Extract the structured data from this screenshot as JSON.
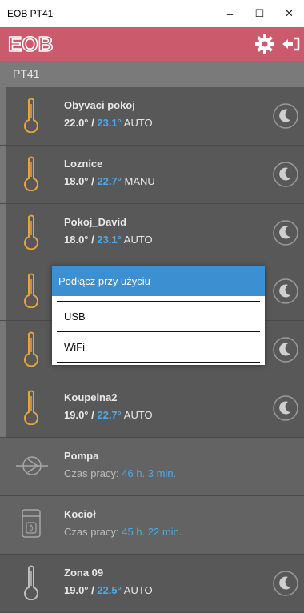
{
  "window": {
    "title": "EOB PT41",
    "min": "–",
    "max": "☐",
    "close": "✕"
  },
  "app": {
    "logo": "EOB",
    "settings_icon": "gear-icon",
    "logout_icon": "exit-icon"
  },
  "device": {
    "name": "PT41"
  },
  "zones": [
    {
      "name": "Obyvaci pokoj",
      "set": "22.0°",
      "sep": " / ",
      "actual": "23.1°",
      "mode": "AUTO"
    },
    {
      "name": "Loznice",
      "set": "18.0°",
      "sep": " / ",
      "actual": "22.7°",
      "mode": "MANU"
    },
    {
      "name": "Pokoj_David",
      "set": "18.0°",
      "sep": " / ",
      "actual": "23.1°",
      "mode": "AUTO"
    },
    {
      "name": "",
      "set": "",
      "sep": "",
      "actual": "",
      "mode": ""
    },
    {
      "name": "",
      "set": "",
      "sep": "",
      "actual": "",
      "mode": ""
    },
    {
      "name": "Koupelna2",
      "set": "19.0°",
      "sep": " / ",
      "actual": "22.7°",
      "mode": "AUTO"
    }
  ],
  "pump": {
    "name": "Pompa",
    "label": "Czas pracy: ",
    "value": "46 h. 3 min."
  },
  "boiler": {
    "name": "Kocioł",
    "label": "Czas pracy: ",
    "value": "45 h. 22 min."
  },
  "zone9": {
    "name": "Zona 09",
    "set": "19.0°",
    "sep": " / ",
    "actual": "22.5°",
    "mode": "AUTO"
  },
  "dialog": {
    "title": "Podłącz przy użyciu",
    "options": [
      "USB",
      "WiFi"
    ]
  },
  "colors": {
    "header": "#ca5a6c",
    "accent": "#4ea9e6",
    "row_bg": "#585858",
    "dialog_title": "#3c8fd1"
  }
}
